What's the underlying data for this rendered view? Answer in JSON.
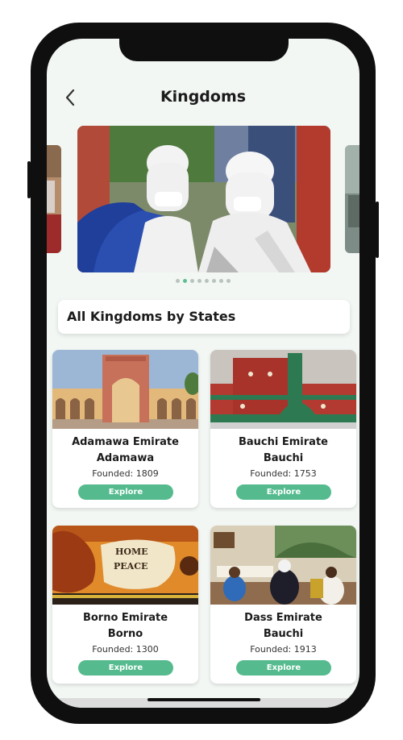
{
  "header": {
    "title": "Kingdoms",
    "back_icon": "chevron-left-icon"
  },
  "carousel": {
    "slide_count": 8,
    "active_index": 1
  },
  "section": {
    "title": "All Kingdoms by States"
  },
  "kingdoms": [
    {
      "name": "Adamawa Emirate",
      "state": "Adamawa",
      "founded": "Founded: 1809",
      "button": "Explore"
    },
    {
      "name": "Bauchi Emirate",
      "state": "Bauchi",
      "founded": "Founded: 1753",
      "button": "Explore"
    },
    {
      "name": "Borno Emirate",
      "state": "Borno",
      "founded": "Founded: 1300",
      "button": "Explore"
    },
    {
      "name": "Dass Emirate",
      "state": "Bauchi",
      "founded": "Founded: 1913",
      "button": "Explore"
    }
  ],
  "colors": {
    "accent": "#55bb8e",
    "dot_active": "#5fbd93",
    "dot_inactive": "#b8c4bd"
  }
}
